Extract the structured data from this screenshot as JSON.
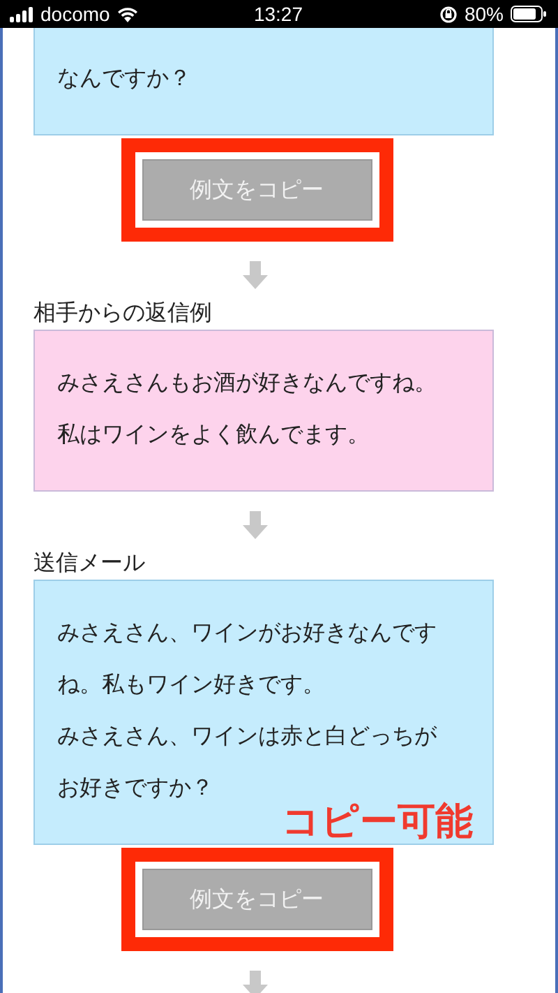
{
  "status_bar": {
    "carrier": "docomo",
    "time": "13:27",
    "battery": "80%"
  },
  "blocks": [
    {
      "kind": "message",
      "color": "#c5ecfd",
      "paragraphs": [
        "なんですか？"
      ]
    },
    {
      "kind": "copy_button",
      "label": "例文をコピー",
      "highlighted": true
    },
    {
      "kind": "arrow"
    },
    {
      "kind": "heading",
      "text": "相手からの返信例"
    },
    {
      "kind": "message",
      "color": "#fdd3ec",
      "paragraphs": [
        "みさえさんもお酒が好きなんですね。",
        "私はワインをよく飲んでます。"
      ]
    },
    {
      "kind": "arrow"
    },
    {
      "kind": "heading",
      "text": "送信メール"
    },
    {
      "kind": "message",
      "color": "#c5ecfd",
      "paragraphs": [
        "みさえさん、ワインがお好きなんですね。私もワイン好きです。",
        "みさえさん、ワインは赤と白どっちがお好きですか？"
      ],
      "annotation": "コピー可能"
    },
    {
      "kind": "copy_button",
      "label": "例文をコピー",
      "highlighted": true
    },
    {
      "kind": "arrow"
    }
  ]
}
